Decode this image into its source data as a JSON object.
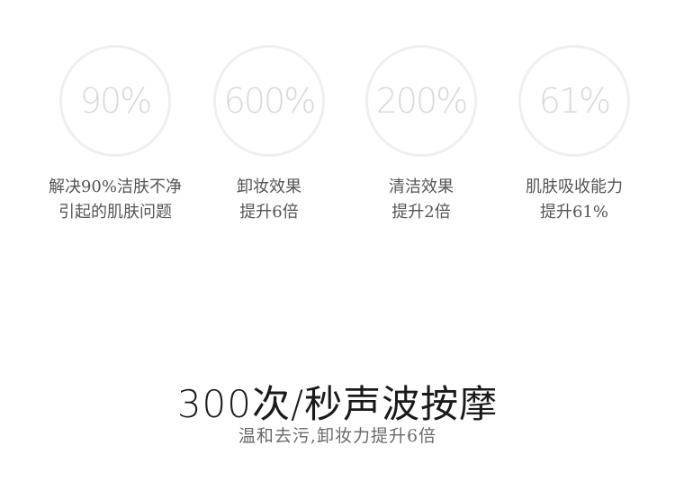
{
  "stats": [
    {
      "value": "90%",
      "caption_line1": "解决90%洁肤不净",
      "caption_line2": "引起的肌肤问题"
    },
    {
      "value": "600%",
      "caption_line1": "卸妆效果",
      "caption_line2": "提升6倍"
    },
    {
      "value": "200%",
      "caption_line1": "清洁效果",
      "caption_line2": "提升2倍"
    },
    {
      "value": "61%",
      "caption_line1": "肌肤吸收能力",
      "caption_line2": "提升61%"
    }
  ],
  "headline": "300次/秒声波按摩",
  "subline": "温和去污,卸妆力提升6倍",
  "colors": {
    "ring": "#efefef",
    "ring_text": "#d9d9d9",
    "caption": "#555555",
    "headline": "#1a1a1a"
  }
}
